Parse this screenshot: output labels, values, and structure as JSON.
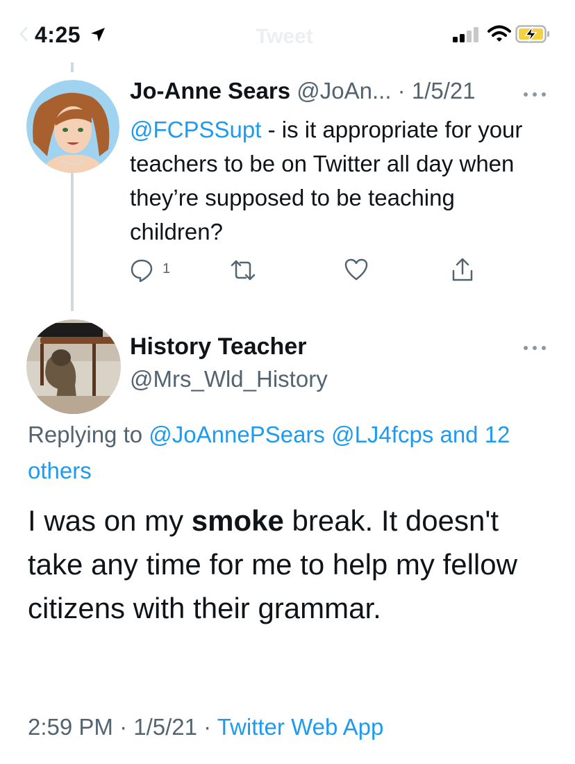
{
  "status_bar": {
    "time": "4:25",
    "nav_title": "Tweet"
  },
  "tweet1": {
    "author_name": "Jo-Anne Sears",
    "author_handle": "@JoAn...",
    "separator": " · ",
    "date": "1/5/21",
    "mention": "@FCPSSupt",
    "text": " - is it appropriate for your teachers to be on Twitter all day when they’re supposed to be teaching children?",
    "reply_count": "1"
  },
  "tweet2": {
    "author_name": "History Teacher",
    "author_handle": "@Mrs_Wld_History",
    "replying_prefix": "Replying to ",
    "replying_to": "@JoAnnePSears @LJ4fcps and 12 others",
    "text_before": "I was on my ",
    "text_bold": "smoke",
    "text_after": " break.  It doesn't take any time for me to help my fellow citizens with their grammar.",
    "time": "2:59 PM",
    "separator": " · ",
    "date": "1/5/21",
    "separator2": " · ",
    "source": "Twitter Web App"
  },
  "colors": {
    "accent": "#1d9bf0",
    "secondary_text": "#536471",
    "primary_text": "#0f1419",
    "battery_fill": "#f5d142"
  }
}
